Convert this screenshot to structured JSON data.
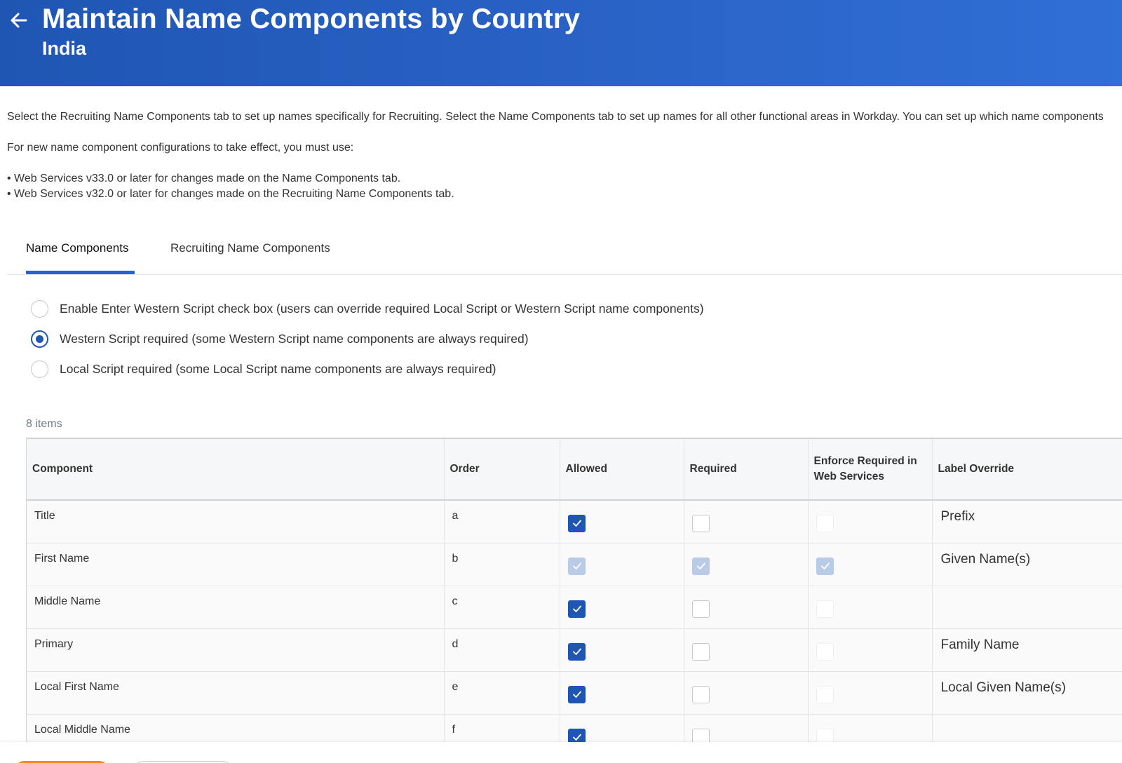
{
  "header": {
    "title": "Maintain Name Components by Country",
    "subtitle": "India",
    "back_icon": "arrow-left-icon"
  },
  "intro": {
    "line1": "Select the Recruiting Name Components tab to set up names specifically for Recruiting. Select the Name Components tab to set up names for all other functional areas in Workday. You can set up which name components",
    "line2": "For new name component configurations to take effect, you must use:",
    "bullet1": "• Web Services v33.0 or later for changes made on the Name Components tab.",
    "bullet2": "• Web Services v32.0 or later for changes made on the Recruiting Name Components tab."
  },
  "tabs": [
    {
      "label": "Name Components",
      "active": true
    },
    {
      "label": "Recruiting Name Components",
      "active": false
    }
  ],
  "options": [
    {
      "label": "Enable Enter Western Script check box (users can override required Local Script or Western Script name components)",
      "selected": false
    },
    {
      "label": "Western Script required (some Western Script name components are always required)",
      "selected": true
    },
    {
      "label": "Local Script required (some Local Script name components are always required)",
      "selected": false
    }
  ],
  "grid": {
    "count_label": "8 items",
    "columns": [
      "Component",
      "Order",
      "Allowed",
      "Required",
      "Enforce Required in Web Services",
      "Label Override"
    ],
    "rows": [
      {
        "component": "Title",
        "order": "a",
        "allowed": "on",
        "required": "off",
        "enforce": "dis-off",
        "label": "Prefix"
      },
      {
        "component": "First Name",
        "order": "b",
        "allowed": "dis-on",
        "required": "dis-on",
        "enforce": "dis-on",
        "label": "Given Name(s)"
      },
      {
        "component": "Middle Name",
        "order": "c",
        "allowed": "on",
        "required": "off",
        "enforce": "dis-off",
        "label": ""
      },
      {
        "component": "Primary",
        "order": "d",
        "allowed": "on",
        "required": "off",
        "enforce": "dis-off",
        "label": "Family Name"
      },
      {
        "component": "Local First Name",
        "order": "e",
        "allowed": "on",
        "required": "off",
        "enforce": "dis-off",
        "label": "Local Given Name(s)"
      },
      {
        "component": "Local Middle Name",
        "order": "f",
        "allowed": "on",
        "required": "off",
        "enforce": "dis-off",
        "label": ""
      }
    ]
  },
  "colors": {
    "header_blue": "#2a63c6",
    "checkbox_blue": "#1f56b4",
    "primary_button": "#f38b2b"
  }
}
